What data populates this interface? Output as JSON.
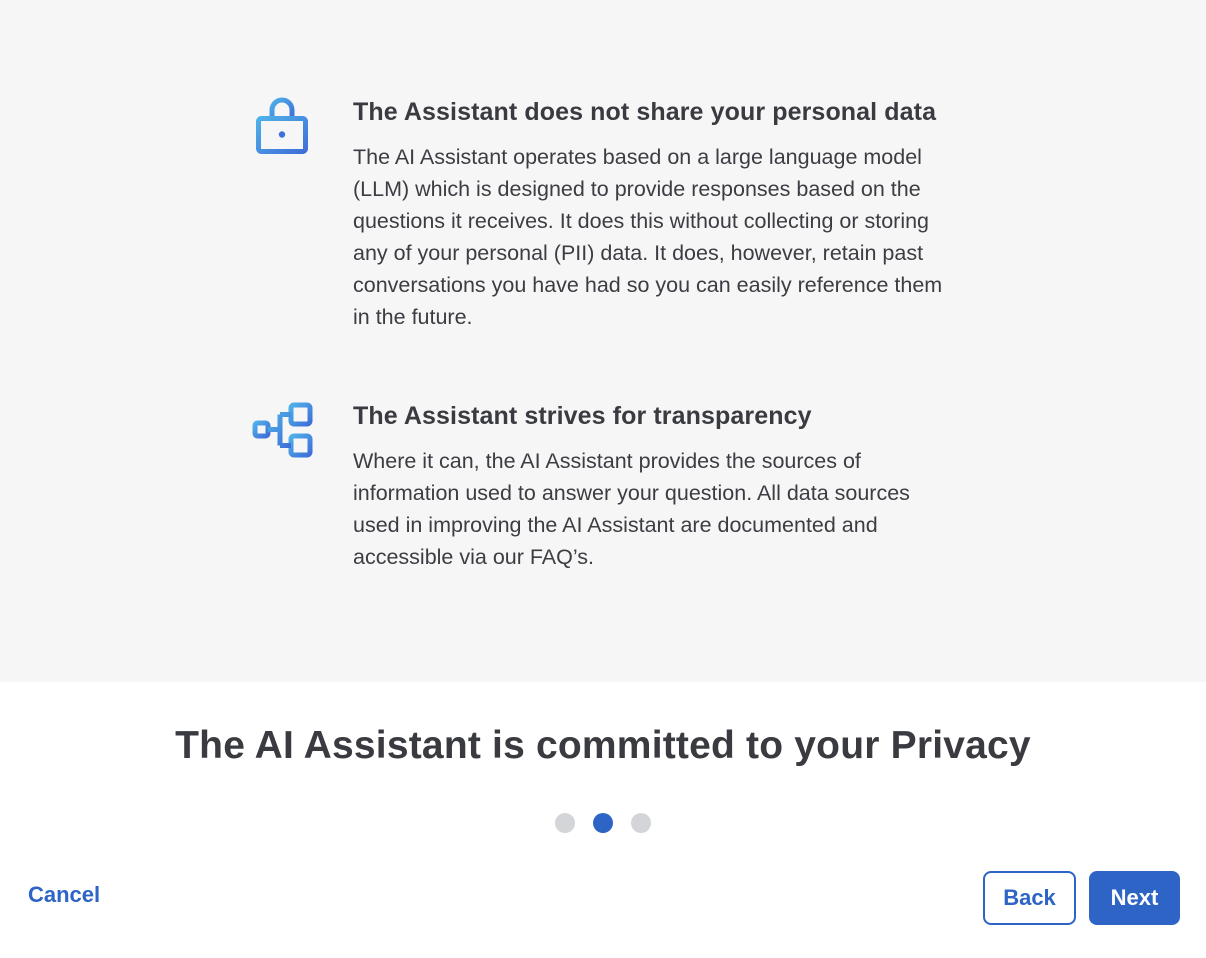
{
  "features": [
    {
      "icon": "lock-icon",
      "title": "The Assistant does not share your personal data",
      "body": "The AI Assistant operates based on a large language model (LLM) which is designed to provide responses based on the questions it receives. It does this without collecting or storing any of your personal (PII) data. It does, however, retain past conversations you have had so you can easily reference them in the future."
    },
    {
      "icon": "sitemap-icon",
      "title": "The Assistant strives for transparency",
      "body": "Where it can, the AI Assistant provides the sources of information used to answer your question. All data sources used in improving the AI Assistant are documented and accessible via our FAQ’s."
    }
  ],
  "title": "The AI Assistant is committed to your Privacy",
  "pagination": {
    "total": 3,
    "current": 2
  },
  "footer": {
    "cancel_label": "Cancel",
    "back_label": "Back",
    "next_label": "Next"
  },
  "colors": {
    "accent": "#2e64c5",
    "icon_gradient_start": "#4fb0e8",
    "icon_gradient_end": "#3f6fd8",
    "panel_bg": "#f6f6f7",
    "dot_inactive": "#d3d5d9"
  }
}
